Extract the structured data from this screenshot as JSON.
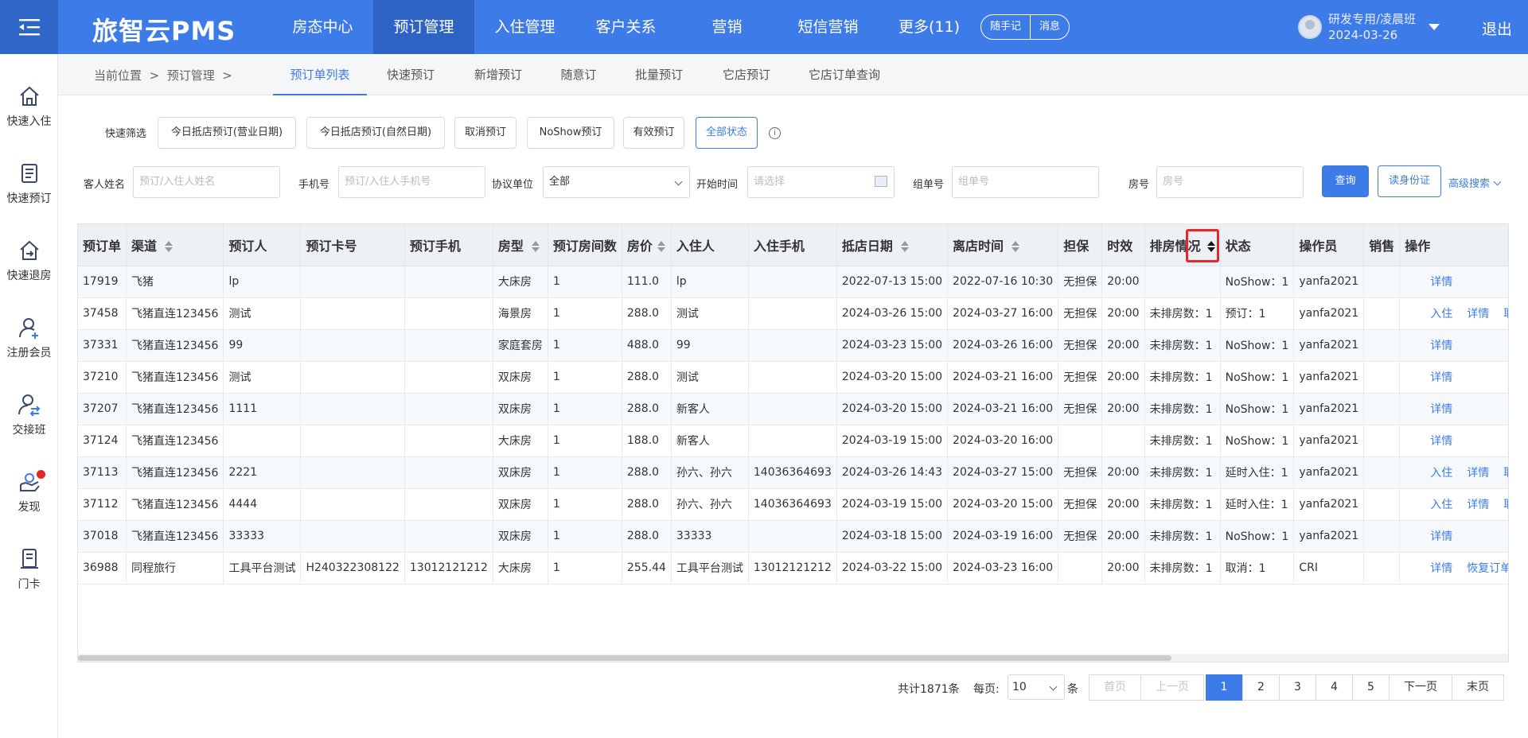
{
  "header": {
    "logo": "旅智云PMS",
    "nav": [
      "房态中心",
      "预订管理",
      "入住管理",
      "客户关系",
      "营销",
      "短信营销",
      "更多(11)"
    ],
    "pills": [
      "随手记",
      "消息"
    ],
    "user_name": "研发专用/凌晨班",
    "user_date": "2024-03-26",
    "logout": "退出"
  },
  "sidebar": {
    "items": [
      {
        "label": "快速入住",
        "icon": "home-icon"
      },
      {
        "label": "快速预订",
        "icon": "document-icon"
      },
      {
        "label": "快速退房",
        "icon": "checkout-icon"
      },
      {
        "label": "注册会员",
        "icon": "add-user-icon"
      },
      {
        "label": "交接班",
        "icon": "handover-icon"
      },
      {
        "label": "发现",
        "icon": "discover-icon"
      },
      {
        "label": "门卡",
        "icon": "card-icon"
      }
    ]
  },
  "breadcrumb": {
    "current": "当前位置",
    "sep": ">",
    "section": "预订管理",
    "sep2": ">"
  },
  "tabs": [
    "预订单列表",
    "快速预订",
    "新增预订",
    "随意订",
    "批量预订",
    "它店预订",
    "它店订单查询"
  ],
  "quick_filter": {
    "label": "快速筛选",
    "buttons": [
      "今日抵店预订(营业日期)",
      "今日抵店预订(自然日期)",
      "取消预订",
      "NoShow预订",
      "有效预订",
      "全部状态"
    ]
  },
  "filters": {
    "guest_name": {
      "label": "客人姓名",
      "placeholder": "预订/入住人姓名"
    },
    "phone": {
      "label": "手机号",
      "placeholder": "预订/入住人手机号"
    },
    "agreement": {
      "label": "协议单位",
      "value": "全部"
    },
    "start_time": {
      "label": "开始时间",
      "placeholder": "请选择"
    },
    "group_no": {
      "label": "组单号",
      "placeholder": "组单号"
    },
    "room_no": {
      "label": "房号",
      "placeholder": "房号"
    },
    "query_btn": "查询",
    "read_id_btn": "读身份证",
    "advanced": "高级搜索"
  },
  "table": {
    "headers": [
      "预订单",
      "渠道",
      "预订人",
      "预订卡号",
      "预订手机",
      "房型",
      "预订房间数",
      "房价",
      "入住人",
      "入住手机",
      "抵店日期",
      "离店时间",
      "担保",
      "时效",
      "排房情况",
      "状态",
      "操作员",
      "销售",
      "操作"
    ],
    "rows": [
      {
        "cells": [
          "17919",
          "飞猪",
          "lp",
          "",
          "",
          "大床房",
          "1",
          "111.0",
          "lp",
          "",
          "2022-07-13 15:00",
          "2022-07-16 10:30",
          "无担保",
          "20:00",
          "",
          "NoShow：1",
          "yanfa2021",
          ""
        ],
        "actions": [
          "详情"
        ]
      },
      {
        "cells": [
          "37458",
          "飞猪直连123456",
          "测试",
          "",
          "",
          "海景房",
          "1",
          "288.0",
          "测试",
          "",
          "2024-03-26 15:00",
          "2024-03-27 16:00",
          "无担保",
          "20:00",
          "未排房数：1",
          "预订：1",
          "yanfa2021",
          ""
        ],
        "actions": [
          "入住",
          "详情",
          "取消订单"
        ]
      },
      {
        "cells": [
          "37331",
          "飞猪直连123456",
          "99",
          "",
          "",
          "家庭套房",
          "1",
          "488.0",
          "99",
          "",
          "2024-03-23 15:00",
          "2024-03-26 16:00",
          "无担保",
          "20:00",
          "未排房数：1",
          "NoShow：1",
          "yanfa2021",
          ""
        ],
        "actions": [
          "详情"
        ]
      },
      {
        "cells": [
          "37210",
          "飞猪直连123456",
          "测试",
          "",
          "",
          "双床房",
          "1",
          "288.0",
          "测试",
          "",
          "2024-03-20 15:00",
          "2024-03-21 16:00",
          "无担保",
          "20:00",
          "未排房数：1",
          "NoShow：1",
          "yanfa2021",
          ""
        ],
        "actions": [
          "详情"
        ]
      },
      {
        "cells": [
          "37207",
          "飞猪直连123456",
          "1111",
          "",
          "",
          "双床房",
          "1",
          "288.0",
          "新客人",
          "",
          "2024-03-20 15:00",
          "2024-03-21 16:00",
          "无担保",
          "20:00",
          "未排房数：1",
          "NoShow：1",
          "yanfa2021",
          ""
        ],
        "actions": [
          "详情"
        ]
      },
      {
        "cells": [
          "37124",
          "飞猪直连123456",
          "",
          "",
          "",
          "大床房",
          "1",
          "188.0",
          "新客人",
          "",
          "2024-03-19 15:00",
          "2024-03-20 16:00",
          "",
          "",
          "未排房数：1",
          "NoShow：1",
          "yanfa2021",
          ""
        ],
        "actions": [
          "详情"
        ]
      },
      {
        "cells": [
          "37113",
          "飞猪直连123456",
          "2221",
          "",
          "",
          "双床房",
          "1",
          "288.0",
          "孙六、孙六",
          "14036364693",
          "2024-03-26 14:43",
          "2024-03-27 15:00",
          "无担保",
          "20:00",
          "未排房数：1",
          "延时入住：1",
          "yanfa2021",
          ""
        ],
        "actions": [
          "入住",
          "详情",
          "取消订单"
        ]
      },
      {
        "cells": [
          "37112",
          "飞猪直连123456",
          "4444",
          "",
          "",
          "双床房",
          "1",
          "288.0",
          "孙六、孙六",
          "14036364693",
          "2024-03-19 15:00",
          "2024-03-20 15:00",
          "无担保",
          "20:00",
          "未排房数：1",
          "延时入住：1",
          "yanfa2021",
          ""
        ],
        "actions": [
          "入住",
          "详情",
          "取消订单"
        ]
      },
      {
        "cells": [
          "37018",
          "飞猪直连123456",
          "33333",
          "",
          "",
          "双床房",
          "1",
          "288.0",
          "33333",
          "",
          "2024-03-18 15:00",
          "2024-03-19 16:00",
          "无担保",
          "20:00",
          "未排房数：1",
          "NoShow：1",
          "yanfa2021",
          ""
        ],
        "actions": [
          "详情"
        ]
      },
      {
        "cells": [
          "36988",
          "同程旅行",
          "工具平台测试",
          "H240322308122",
          "13012121212",
          "大床房",
          "1",
          "255.44",
          "工具平台测试",
          "13012121212",
          "2024-03-22 15:00",
          "2024-03-23 16:00",
          "",
          "20:00",
          "未排房数：1",
          "取消：1",
          "CRI",
          ""
        ],
        "actions": [
          "详情",
          "恢复订单"
        ]
      }
    ]
  },
  "pagination": {
    "total": "共计1871条",
    "per_page_label": "每页:",
    "per_page_value": "10",
    "per_page_unit": "条",
    "first": "首页",
    "prev": "上一页",
    "pages": [
      "1",
      "2",
      "3",
      "4",
      "5"
    ],
    "next": "下一页",
    "last": "末页"
  }
}
